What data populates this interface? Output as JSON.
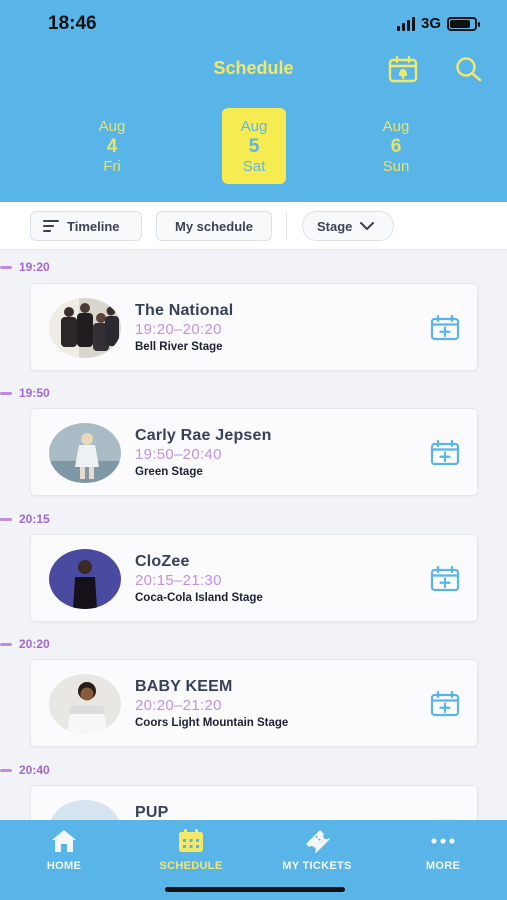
{
  "status": {
    "time": "18:46",
    "network": "3G"
  },
  "header": {
    "title": "Schedule"
  },
  "dates": [
    {
      "month": "Aug",
      "day": "4",
      "weekday": "Fri",
      "selected": false
    },
    {
      "month": "Aug",
      "day": "5",
      "weekday": "Sat",
      "selected": true
    },
    {
      "month": "Aug",
      "day": "6",
      "weekday": "Sun",
      "selected": false
    }
  ],
  "filters": {
    "timeline": "Timeline",
    "my_schedule": "My schedule",
    "stage": "Stage"
  },
  "events": [
    {
      "marker": "19:20",
      "artist": "The National",
      "slot": "19:20–20:20",
      "stage": "Bell River Stage"
    },
    {
      "marker": "19:50",
      "artist": "Carly Rae Jepsen",
      "slot": "19:50–20:40",
      "stage": "Green Stage"
    },
    {
      "marker": "20:15",
      "artist": "CloZee",
      "slot": "20:15–21:30",
      "stage": "Coca-Cola Island Stage"
    },
    {
      "marker": "20:20",
      "artist": "BABY KEEM",
      "slot": "20:20–21:20",
      "stage": "Coors Light Mountain Stage"
    },
    {
      "marker": "20:40",
      "artist": "PUP",
      "slot": "",
      "stage": ""
    }
  ],
  "tabs": {
    "home": "HOME",
    "schedule": "SCHEDULE",
    "tickets": "MY TICKETS",
    "more": "MORE"
  },
  "colors": {
    "brand_blue": "#59b4e7",
    "accent_yellow": "#f2e96a",
    "time_purple": "#a367cf"
  }
}
